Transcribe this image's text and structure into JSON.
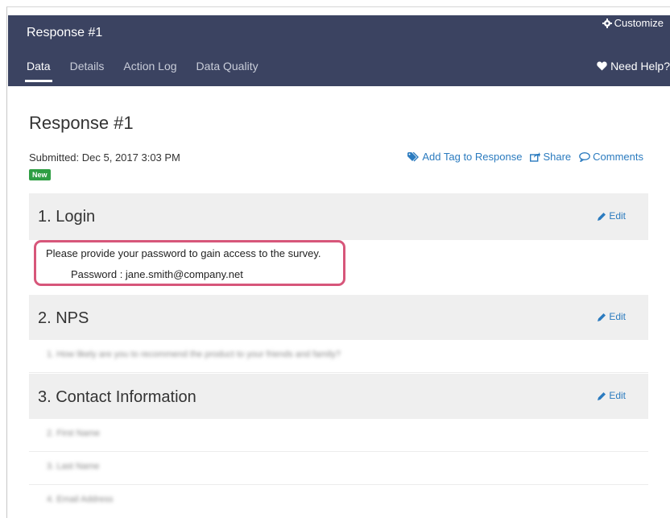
{
  "header": {
    "title": "Response #1",
    "customize_label": "Customize",
    "need_help_label": "Need Help?",
    "tabs": [
      {
        "label": "Data",
        "active": true
      },
      {
        "label": "Details",
        "active": false
      },
      {
        "label": "Action Log",
        "active": false
      },
      {
        "label": "Data Quality",
        "active": false
      }
    ]
  },
  "main": {
    "title": "Response #1",
    "submitted": "Submitted: Dec 5, 2017 3:03 PM",
    "badge": "New",
    "actions": {
      "add_tag": "Add Tag to Response",
      "share": "Share",
      "comments": "Comments"
    },
    "edit_label": "Edit",
    "sections": [
      {
        "title": "1. Login",
        "question": "Please provide your password to gain access to the survey.",
        "answer": "Password : jane.smith@company.net"
      },
      {
        "title": "2. NPS",
        "rows": [
          "1. How likely are you to recommend the product to your friends and family?"
        ]
      },
      {
        "title": "3. Contact Information",
        "rows": [
          "2. First Name",
          "3. Last Name",
          "4. Email Address"
        ]
      }
    ]
  },
  "colors": {
    "header_bg": "#3b4361",
    "link": "#2b7bbf",
    "badge": "#2f9e44",
    "highlight": "#d7567a",
    "section_bg": "#efefef"
  }
}
